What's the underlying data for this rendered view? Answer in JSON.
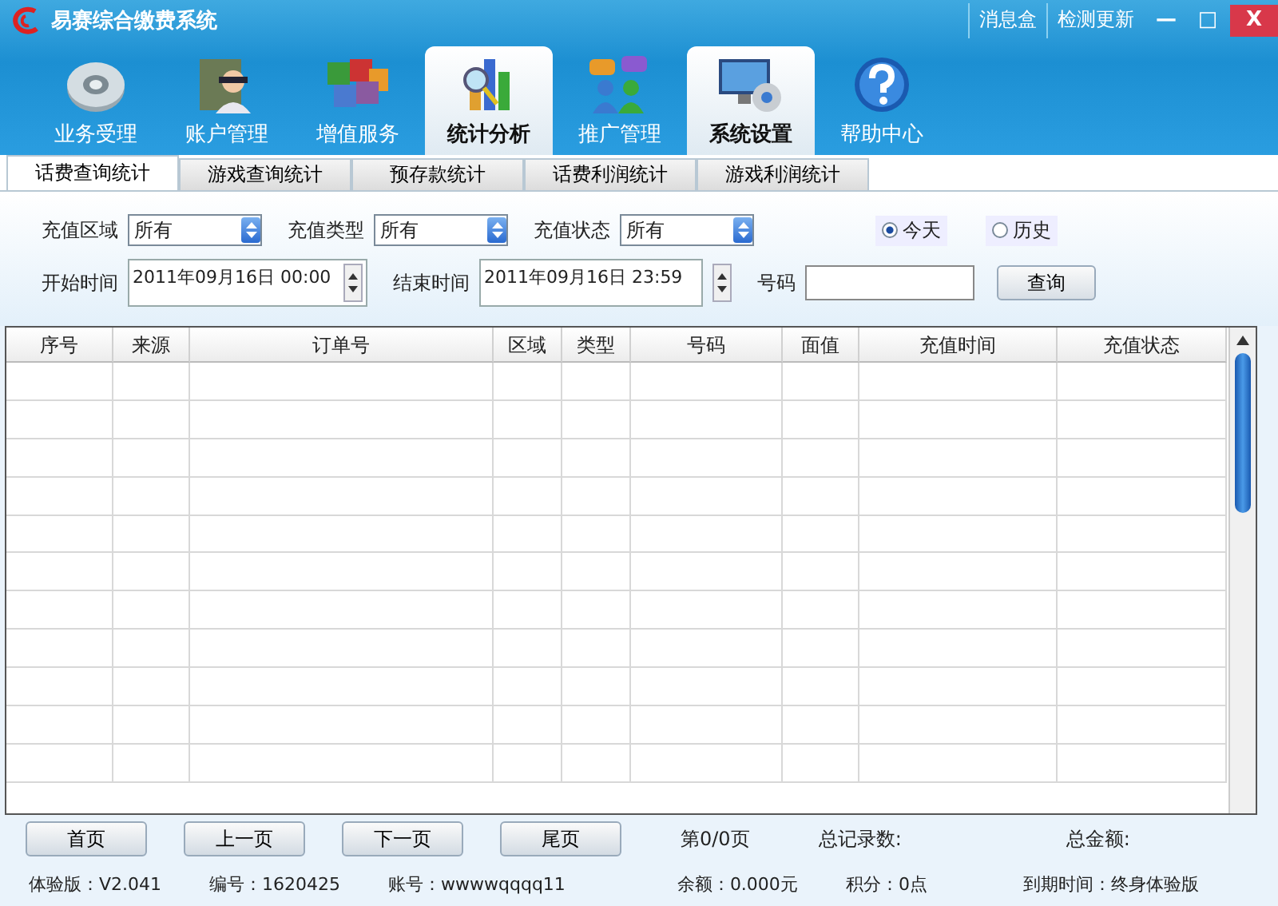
{
  "window": {
    "title": "易赛综合缴费系统",
    "links": [
      "消息盒",
      "检测更新"
    ],
    "controls": [
      "—",
      "□",
      "X"
    ]
  },
  "toolbar": [
    {
      "label": "业务受理",
      "selected": false
    },
    {
      "label": "账户管理",
      "selected": false
    },
    {
      "label": "增值服务",
      "selected": false
    },
    {
      "label": "统计分析",
      "selected": true
    },
    {
      "label": "推广管理",
      "selected": false
    },
    {
      "label": "系统设置",
      "selected": true
    },
    {
      "label": "帮助中心",
      "selected": false
    }
  ],
  "tabs": [
    {
      "label": "话费查询统计",
      "selected": true
    },
    {
      "label": "游戏查询统计",
      "selected": false
    },
    {
      "label": "预存款统计",
      "selected": false
    },
    {
      "label": "话费利润统计",
      "selected": false
    },
    {
      "label": "游戏利润统计",
      "selected": false
    }
  ],
  "filters": {
    "dropdowns": [
      {
        "label": "充值区域",
        "value": "所有"
      },
      {
        "label": "充值类型",
        "value": "所有"
      },
      {
        "label": "充值状态",
        "value": "所有"
      }
    ],
    "period": [
      {
        "label": "今天",
        "selected": true
      },
      {
        "label": "历史",
        "selected": false
      }
    ],
    "start": {
      "label": "开始时间",
      "value": "2011年09月16日 00:00"
    },
    "end": {
      "label": "结束时间",
      "value": "2011年09月16日 23:59"
    },
    "number": {
      "label": "号码"
    },
    "query_button": "查询"
  },
  "table": {
    "columns": [
      "序号",
      "来源",
      "订单号",
      "区域",
      "类型",
      "号码",
      "面值",
      "充值时间",
      "充值状态"
    ]
  },
  "pager": {
    "buttons": [
      "首页",
      "上一页",
      "下一页",
      "尾页"
    ],
    "page": "第0/0页",
    "total_records": "总记录数:",
    "total_amount": "总金额:"
  },
  "status_bar": [
    "体验版：V2.041",
    "编号：1620425",
    "账号：wwwwqqqq11",
    "余额：0.000元",
    "积分：0点",
    "到期时间：终身体验版"
  ]
}
